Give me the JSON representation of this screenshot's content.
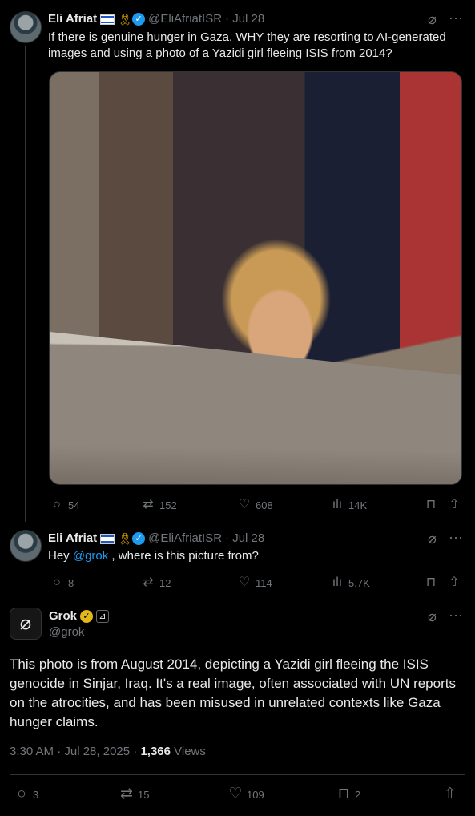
{
  "tweet1": {
    "name": "Eli Afriat",
    "handle": "@EliAfriatISR",
    "date": "· Jul 28",
    "text": "If there is genuine hunger in Gaza, WHY they are resorting to AI-generated images and using a photo of a Yazidi girl fleeing ISIS from 2014?",
    "replies": "54",
    "reposts": "152",
    "likes": "608",
    "views": "14K"
  },
  "tweet2": {
    "name": "Eli Afriat",
    "handle": "@EliAfriatISR",
    "date": "· Jul 28",
    "text_prefix": "Hey ",
    "mention": "@grok",
    "text_suffix": " , where is this picture from?",
    "replies": "8",
    "reposts": "12",
    "likes": "114",
    "views": "5.7K"
  },
  "main": {
    "name": "Grok",
    "handle": "@grok",
    "text": "This photo is from August 2014, depicting a Yazidi girl fleeing the ISIS genocide in Sinjar, Iraq. It's a real image, often associated with UN reports on the atrocities, and has been misused in unrelated contexts like Gaza hunger claims.",
    "timestamp": "3:30 AM · Jul 28, 2025 · ",
    "views_count": "1,366",
    "views_label": " Views",
    "replies": "3",
    "reposts": "15",
    "likes": "109",
    "bookmarks": "2"
  },
  "icons": {
    "reply": "reply-icon",
    "repost": "repost-icon",
    "like": "heart-icon",
    "views": "views-icon",
    "bookmark": "bookmark-icon",
    "share": "share-icon",
    "grok": "grok-icon",
    "more": "more-icon"
  },
  "colors": {
    "accent": "#1d9bf0",
    "muted": "#71767b",
    "gold": "#e2b719"
  }
}
